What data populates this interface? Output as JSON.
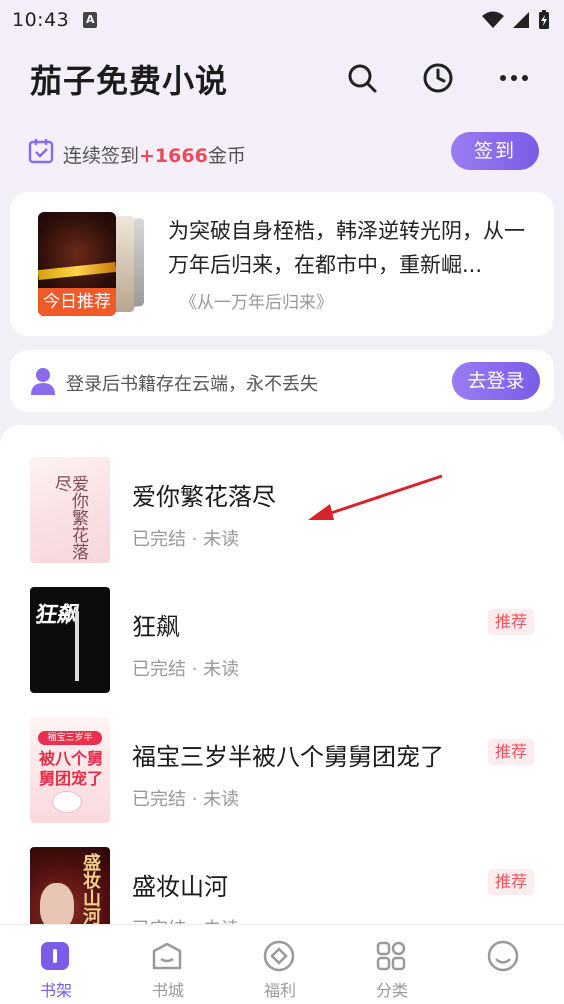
{
  "status_bar": {
    "time": "10:43",
    "notification_letter": "A"
  },
  "header": {
    "title": "茄子免费小说"
  },
  "checkin": {
    "text_prefix": "连续签到",
    "bonus": "+1666",
    "text_suffix": "金币",
    "button_label": "签到"
  },
  "recommendation": {
    "badge": "今日推荐",
    "description": "为突破自身桎梏，韩泽逆转光阴，从一万年后归来，在都市中，重新崛...",
    "book": "《从一万年后归来》"
  },
  "login_banner": {
    "text": "登录后书籍存在云端，永不丢失",
    "button_label": "去登录"
  },
  "shelf": {
    "books": [
      {
        "title": "爱你繁花落尽",
        "status": "已完结 · 未读",
        "tag": "",
        "cover_text": "爱你繁花落尽"
      },
      {
        "title": "狂飙",
        "status": "已完结 · 未读",
        "tag": "推荐",
        "cover_text": "狂飙"
      },
      {
        "title": "福宝三岁半被八个舅舅团宠了",
        "status": "已完结 · 未读",
        "tag": "推荐",
        "cover_text": "福宝三岁半",
        "cover_text2": "被八个舅舅团宠了"
      },
      {
        "title": "盛妆山河",
        "status": "已完结 · 未读",
        "tag": "推荐",
        "cover_text": "盛妆山河"
      }
    ]
  },
  "tabbar": {
    "tabs": [
      {
        "label": "书架",
        "icon": "bookshelf-icon",
        "active": true
      },
      {
        "label": "书城",
        "icon": "bookstore-icon",
        "active": false
      },
      {
        "label": "福利",
        "icon": "coin-icon",
        "active": false
      },
      {
        "label": "分类",
        "icon": "category-grid-icon",
        "active": false
      },
      {
        "label": "",
        "icon": "profile-icon",
        "active": false
      }
    ]
  },
  "colors": {
    "accent": "#7b5ce6",
    "highlight": "#f04a5a",
    "badge": "#ef5a28",
    "arrow": "#d9232a"
  }
}
